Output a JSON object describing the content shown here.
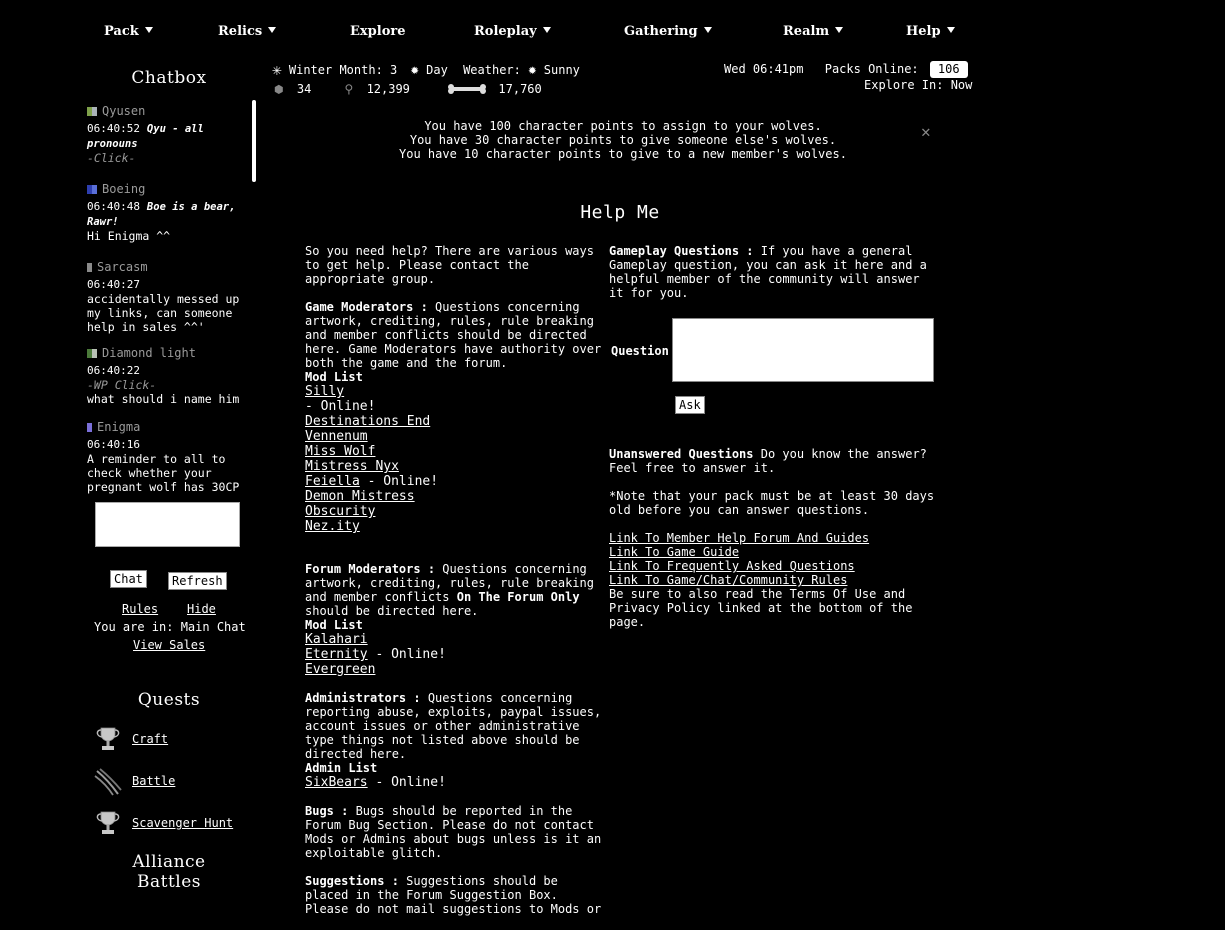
{
  "nav": {
    "items": [
      {
        "label": "Pack",
        "dropdown": true
      },
      {
        "label": "Relics",
        "dropdown": true
      },
      {
        "label": "Explore",
        "dropdown": false
      },
      {
        "label": "Roleplay",
        "dropdown": true
      },
      {
        "label": "Gathering",
        "dropdown": true
      },
      {
        "label": "Realm",
        "dropdown": true
      },
      {
        "label": "Help",
        "dropdown": true
      }
    ]
  },
  "sidebar": {
    "chatbox_title": "Chatbox",
    "messages": [
      {
        "user": "Qyusen",
        "time": "06:40:52",
        "action": "Qyu - all pronouns",
        "extra": "-Click-",
        "text": ""
      },
      {
        "user": "Boeing",
        "time": "06:40:48",
        "action": "Boe is a bear, Rawr!",
        "text": "Hi Enigma ^^"
      },
      {
        "user": "Sarcasm",
        "time": "06:40:27",
        "text": "accidentally messed up my links, can someone help in sales ^^'"
      },
      {
        "user": "Diamond light",
        "time": "06:40:22",
        "extra": "-WP Click-",
        "text": "what should i name him"
      },
      {
        "user": "Enigma",
        "time": "06:40:16",
        "text": "A reminder to all to check whether your pregnant wolf has 30CP"
      }
    ],
    "chat_button": "Chat",
    "refresh_button": "Refresh",
    "rules_link": "Rules",
    "hide_link": "Hide",
    "location_text": "You are in: Main Chat",
    "view_sales_link": "View Sales",
    "quests_title": "Quests",
    "quests": [
      {
        "label": "Craft",
        "icon": "trophy-icon"
      },
      {
        "label": "Battle",
        "icon": "claw-icon"
      },
      {
        "label": "Scavenger Hunt",
        "icon": "trophy-icon"
      }
    ],
    "alliance_title_1": "Alliance",
    "alliance_title_2": "Battles"
  },
  "status": {
    "season": "Winter Month: 3",
    "time_of_day": "Day",
    "weather_label": "Weather:",
    "weather": "Sunny",
    "stat1": "34",
    "stat2": "12,399",
    "stat3": "17,760",
    "datetime": "Wed 06:41pm",
    "packs_online_label": "Packs Online:",
    "packs_online": "106",
    "explore_in": "Explore In: Now"
  },
  "notices": [
    "You have 100 character points to assign to your wolves.",
    "You have 30 character points to give someone else's wolves.",
    "You have 10 character points to give to a new member's wolves."
  ],
  "close_symbol": "✕",
  "help": {
    "title": "Help Me",
    "intro": "So you need help? There are various ways to get help. Please contact the appropriate group.",
    "game_mods_heading": "Game Moderators :",
    "game_mods_text": " Questions concerning artwork, crediting, rules, rule breaking and member conflicts should be directed here. Game Moderators have authority over both the game and the forum.",
    "mod_list_label": "Mod List",
    "game_mods": [
      {
        "name": "Silly",
        "status": " - Online!"
      },
      {
        "name": "Destinations End",
        "status": ""
      },
      {
        "name": "Vennenum",
        "status": ""
      },
      {
        "name": "Miss Wolf",
        "status": ""
      },
      {
        "name": "Mistress Nyx",
        "status": ""
      },
      {
        "name": "Feiella",
        "status": " - Online!"
      },
      {
        "name": "Demon Mistress",
        "status": ""
      },
      {
        "name": "Obscurity",
        "status": ""
      },
      {
        "name": "Nez.ity",
        "status": ""
      }
    ],
    "forum_mods_heading": "Forum Moderators :",
    "forum_mods_text_1": " Questions concerning artwork, crediting, rules, rule breaking and member conflicts ",
    "forum_mods_bold": "On The Forum Only",
    "forum_mods_text_2": " should be directed here.",
    "forum_mod_list_label": "Mod List",
    "forum_mods": [
      {
        "name": "Kalahari",
        "status": ""
      },
      {
        "name": "Eternity",
        "status": " - Online!"
      },
      {
        "name": "Evergreen",
        "status": ""
      }
    ],
    "admins_heading": "Administrators :",
    "admins_text": " Questions concerning reporting abuse, exploits, paypal issues, account issues or other administrative type things not listed above should be directed here.",
    "admin_list_label": "Admin List",
    "admins": [
      {
        "name": "SixBears",
        "status": " - Online!"
      }
    ],
    "bugs_heading": "Bugs :",
    "bugs_text": " Bugs should be reported in the Forum Bug Section. Please do not contact Mods or Admins about bugs unless is it an exploitable glitch.",
    "suggestions_heading": "Suggestions :",
    "suggestions_text": " Suggestions should be placed in the Forum Suggestion Box. Please do not mail suggestions to Mods or",
    "gameplay_heading": "Gameplay Questions :",
    "gameplay_text": " If you have a general Gameplay question, you can ask it here and a helpful member of the community will answer it for you.",
    "question_label": "Question",
    "ask_button": "Ask",
    "unanswered_heading": "Unanswered Questions",
    "unanswered_text": " Do you know the answer? Feel free to answer it.",
    "note_text": "*Note that your pack must be at least 30 days old before you can answer questions.",
    "links": [
      "Link To Member Help Forum And Guides",
      "Link To Game Guide",
      "Link To Frequently Asked Questions",
      "Link To Game/Chat/Community Rules"
    ],
    "terms_text": "Be sure to also read the Terms Of Use and Privacy Policy linked at the bottom of the page."
  }
}
